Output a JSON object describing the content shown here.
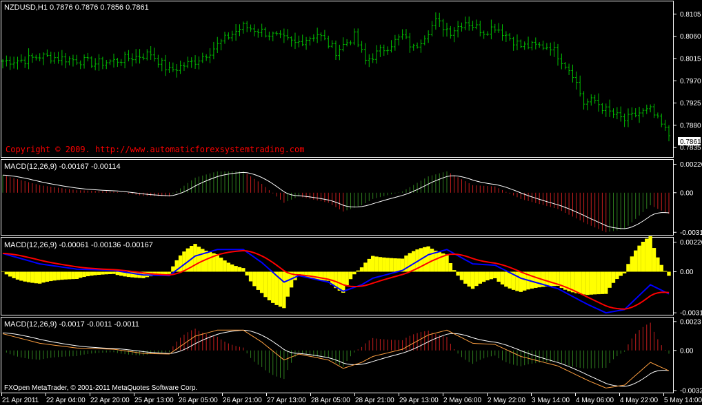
{
  "main": {
    "title": "NZDUSD,H1  0.7876 0.7876 0.7856 0.7861",
    "price_ticks": [
      "0.8105",
      "0.8060",
      "0.8015",
      "0.7970",
      "0.7925",
      "0.7880",
      "0.7835"
    ],
    "current_price": "0.7861",
    "copyright": "Copyright © 2009. http://www.automaticforexsystemtrading.com"
  },
  "panel1": {
    "title": "MACD(12,26,9) -0.00167 -0.00114",
    "ticks": [
      "0.00226",
      "0.00",
      "-0.00315"
    ]
  },
  "panel2": {
    "title": "MACD(12,26,9) -0.00061 -0.00136 -0.00167",
    "ticks": [
      "0.00226",
      "0.00",
      "-0.00315"
    ]
  },
  "panel3": {
    "title": "MACD(12,26,9) -0.0017 -0.0011 -0.0011",
    "ticks": [
      "0.0023",
      "0.00",
      "-0.0032"
    ]
  },
  "footer": "FXOpen MetaTrader, © 2001-2011 MetaQuotes Software Corp.",
  "time_labels": [
    "21 Apr 2011",
    "22 Apr 04:00",
    "22 Apr 20:00",
    "25 Apr 13:00",
    "26 Apr 05:00",
    "26 Apr 21:00",
    "27 Apr 13:00",
    "28 Apr 05:00",
    "28 Apr 21:00",
    "29 Apr 13:00",
    "2 May 06:00",
    "2 May 22:00",
    "3 May 14:00",
    "4 May 06:00",
    "4 May 22:00",
    "5 May 14:00"
  ],
  "colors": {
    "background": "#000000",
    "grid": "#ffffff",
    "bars": "#00c000",
    "hist_up": "#2e7d1e",
    "hist_down": "#c81e1e",
    "yellow_hist": "#ffff00",
    "macd_blue": "#0000ff",
    "signal_red": "#ff0000",
    "white_line": "#ffffff",
    "orange_line": "#ffa040"
  },
  "chart_data": [
    {
      "type": "ohlc",
      "title": "NZDUSD,H1",
      "ylim": [
        0.782,
        0.8125
      ],
      "keypoints_x": [
        0,
        6,
        10,
        20,
        25,
        30,
        40,
        45,
        52,
        56,
        61,
        65,
        70,
        79,
        85,
        90,
        95,
        98,
        100,
        108,
        111,
        117,
        121,
        125,
        130,
        133,
        140,
        148,
        154,
        157,
        160,
        163,
        168,
        172,
        175,
        180
      ],
      "keypoints_close": [
        0.801,
        0.8012,
        0.802,
        0.8012,
        0.8005,
        0.801,
        0.8025,
        0.799,
        0.801,
        0.803,
        0.806,
        0.808,
        0.807,
        0.8045,
        0.8065,
        0.803,
        0.806,
        0.801,
        0.802,
        0.806,
        0.8035,
        0.809,
        0.807,
        0.809,
        0.807,
        0.808,
        0.804,
        0.804,
        0.7985,
        0.7925,
        0.793,
        0.791,
        0.789,
        0.7905,
        0.791,
        0.786
      ]
    },
    {
      "type": "histogram+line",
      "title": "MACD(12,26,9)",
      "ylim": [
        -0.0033,
        0.0024
      ],
      "keypoints_x": [
        0,
        10,
        20,
        30,
        38,
        45,
        52,
        58,
        65,
        70,
        76,
        80,
        88,
        92,
        97,
        100,
        108,
        115,
        120,
        127,
        133,
        140,
        150,
        158,
        163,
        168,
        175,
        180
      ],
      "keypoints_line": [
        0.0014,
        0.0006,
        0.0002,
        0.0001,
        -0.00025,
        -0.0003,
        0.0012,
        0.0017,
        0.0017,
        0.0007,
        -0.0008,
        -0.0003,
        -0.0008,
        -0.0015,
        -0.001,
        -0.0005,
        0.0001,
        0.0013,
        0.0017,
        0.0006,
        0.0005,
        -0.0005,
        -0.0013,
        -0.0025,
        -0.00315,
        -0.0029,
        -0.001,
        -0.0017
      ],
      "histogram": "line minus signal (EMA 9); green when rising, red when falling"
    },
    {
      "type": "histogram+line",
      "title": "MACD(12,26,9)",
      "ylim": [
        -0.0033,
        0.0024
      ],
      "series": [
        {
          "name": "macd",
          "color": "#0000ff"
        },
        {
          "name": "signal",
          "color": "#ff0000"
        },
        {
          "name": "histogram",
          "color": "#ffff00"
        }
      ],
      "source_series": "same line as panel 2"
    },
    {
      "type": "histogram+line",
      "title": "MACD(12,26,9)",
      "ylim": [
        -0.0033,
        0.0024
      ],
      "series": [
        {
          "name": "macd",
          "color": "#ffffff"
        },
        {
          "name": "signal",
          "color": "#ffa040"
        },
        {
          "name": "histogram",
          "color": "#2e7d1e/#c81e1e"
        }
      ],
      "source_series": "same line as panel 2"
    }
  ]
}
